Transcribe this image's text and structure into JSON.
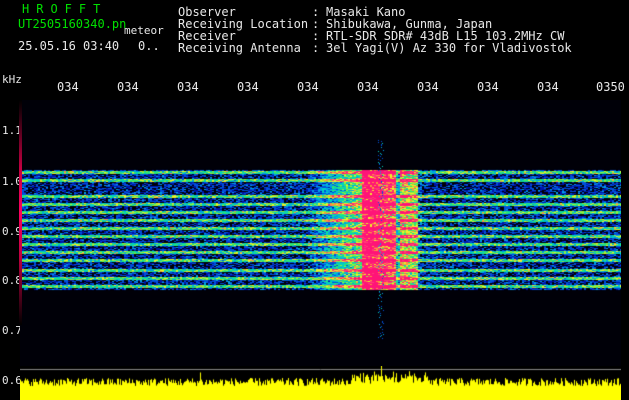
{
  "header": {
    "app_title": "HROFFT",
    "file_name": "UT2505160340.pn",
    "file_mode": "meteor",
    "date_time": "25.05.16 03:40",
    "zoom_level": "0.."
  },
  "station": {
    "rows": [
      {
        "label": "Observer",
        "sep": ":",
        "value": "Masaki Kano"
      },
      {
        "label": "Receiving Location",
        "sep": ":",
        "value": "Shibukawa, Gunma, Japan"
      },
      {
        "label": "Receiver",
        "sep": ":",
        "value": "RTL-SDR SDR# 43dB L15 103.2MHz CW"
      },
      {
        "label": "Receiving Antenna",
        "sep": ":",
        "value": "3el Yagi(V) Az 330 for Vladivostok"
      }
    ]
  },
  "time_axis": {
    "ticks": [
      "034",
      "034",
      "034",
      "034",
      "034",
      "034",
      "034",
      "034",
      "034",
      "0350"
    ]
  },
  "freq_axis": {
    "unit": "kHz",
    "ticks": [
      "1.1",
      "1.0",
      "0.9",
      "0.8",
      "0.7",
      "0.6"
    ]
  },
  "colors": {
    "background": "#000000",
    "header_green": "#00e000",
    "text": "#e8e8e8",
    "trace": "#ffff00"
  }
}
